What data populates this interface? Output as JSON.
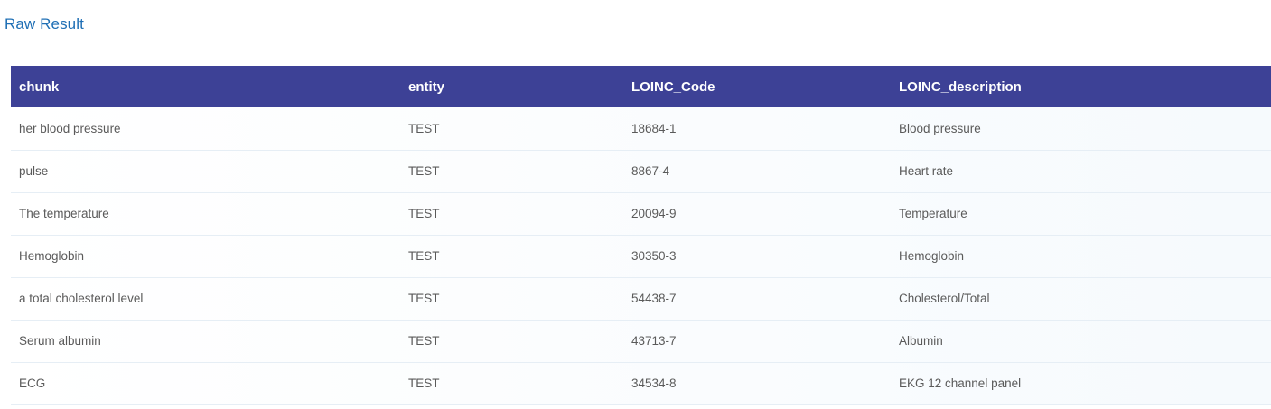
{
  "section": {
    "title": "Raw Result"
  },
  "table": {
    "columns": [
      "chunk",
      "entity",
      "LOINC_Code",
      "LOINC_description"
    ],
    "rows": [
      [
        "her blood pressure",
        "TEST",
        "18684-1",
        "Blood pressure"
      ],
      [
        "pulse",
        "TEST",
        "8867-4",
        "Heart rate"
      ],
      [
        "The temperature",
        "TEST",
        "20094-9",
        "Temperature"
      ],
      [
        "Hemoglobin",
        "TEST",
        "30350-3",
        "Hemoglobin"
      ],
      [
        "a total cholesterol level",
        "TEST",
        "54438-7",
        "Cholesterol/Total"
      ],
      [
        "Serum albumin",
        "TEST",
        "43713-7",
        "Albumin"
      ],
      [
        "ECG",
        "TEST",
        "34534-8",
        "EKG 12 channel panel"
      ]
    ]
  },
  "colors": {
    "title": "#1f6fb5",
    "header_bg": "#3d4196",
    "header_text": "#ffffff",
    "cell_text": "#5a5a5a"
  }
}
